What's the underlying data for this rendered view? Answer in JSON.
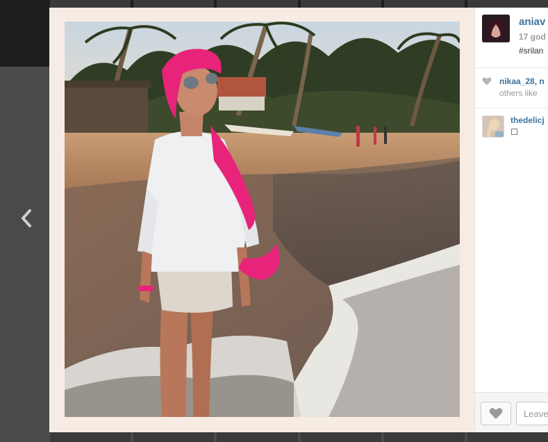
{
  "post": {
    "username": "aniav",
    "time": "17 god",
    "hashtag": "#srilan"
  },
  "likes": {
    "user": "nikaa_28, n",
    "rest": "others like"
  },
  "comments": [
    {
      "user": "thedelicj",
      "text": "☐"
    }
  ],
  "footer": {
    "comment_placeholder": "Leave"
  },
  "colors": {
    "link": "#3f729b",
    "frame": "#f7ece4",
    "scarf": "#e8237a"
  },
  "icons": {
    "prev": "chevron-left-icon",
    "like": "heart-icon"
  }
}
